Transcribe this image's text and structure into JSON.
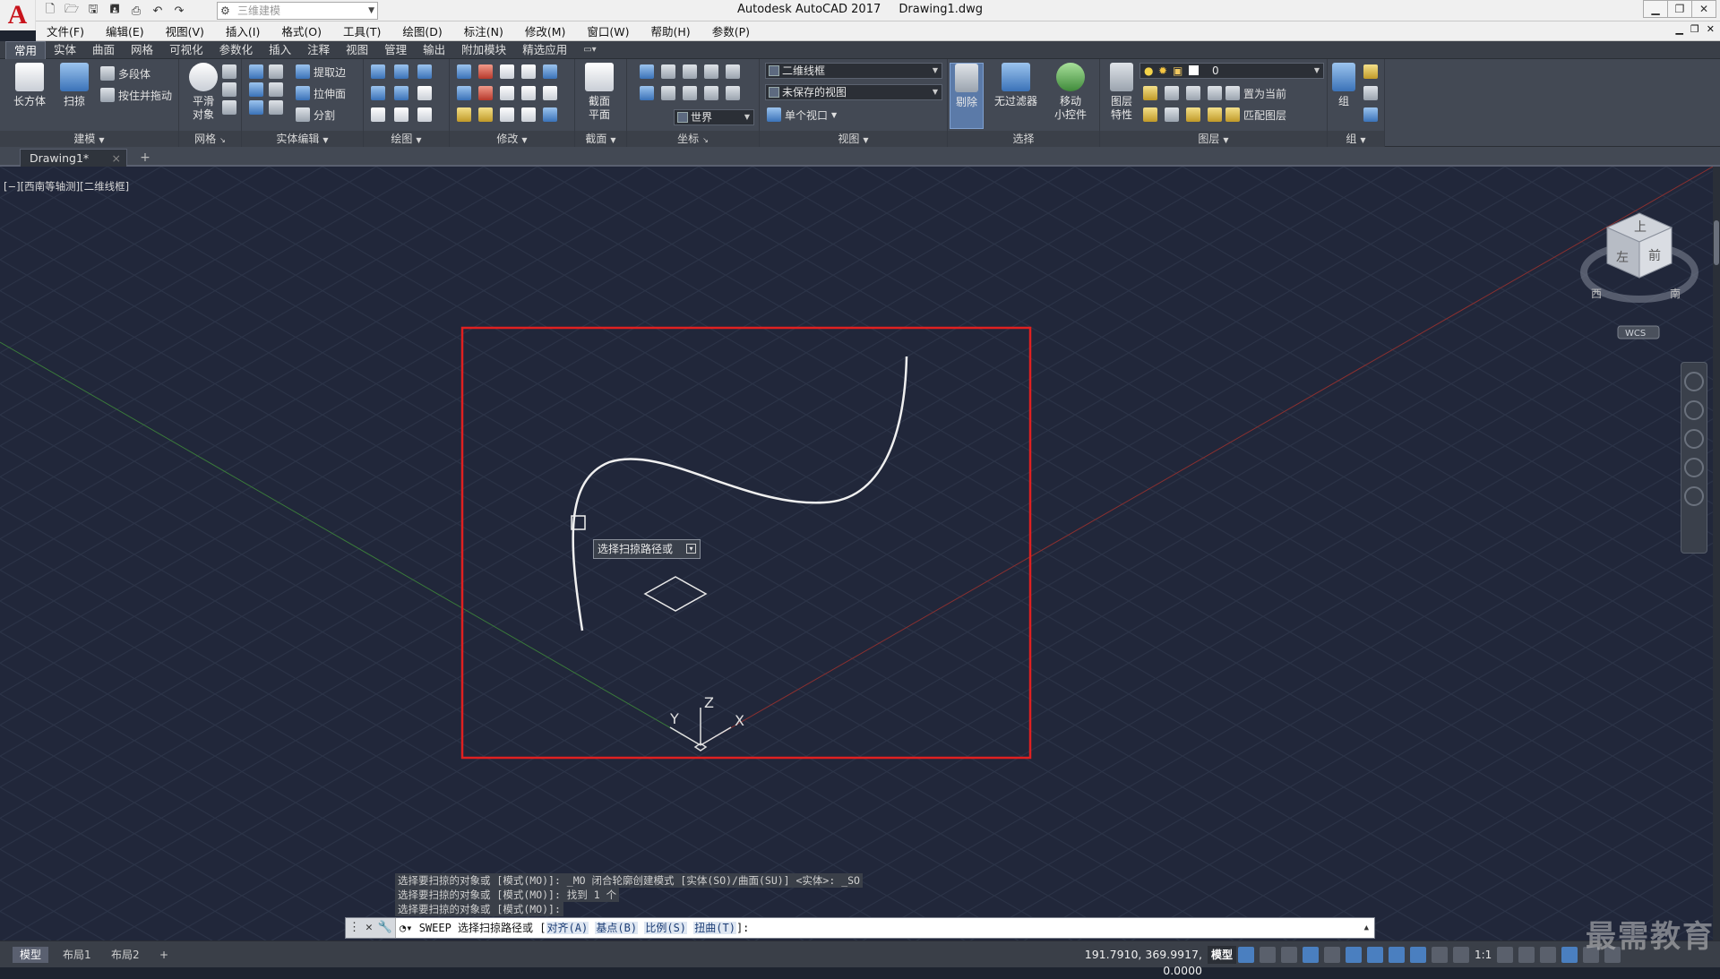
{
  "titlebar": {
    "app_title": "Autodesk AutoCAD 2017",
    "doc_title": "Drawing1.dwg",
    "workspace": "三维建模",
    "logo": "A",
    "quick_access_icons": [
      "new-icon",
      "open-icon",
      "save-icon",
      "saveas-icon",
      "print-icon",
      "undo-icon",
      "redo-icon"
    ],
    "window_controls": [
      "minimize-icon",
      "restore-icon",
      "close-icon"
    ]
  },
  "menubar": {
    "items": [
      "文件(F)",
      "编辑(E)",
      "视图(V)",
      "插入(I)",
      "格式(O)",
      "工具(T)",
      "绘图(D)",
      "标注(N)",
      "修改(M)",
      "窗口(W)",
      "帮助(H)",
      "参数(P)"
    ]
  },
  "ribbon_tabs": {
    "items": [
      "常用",
      "实体",
      "曲面",
      "网格",
      "可视化",
      "参数化",
      "插入",
      "注释",
      "视图",
      "管理",
      "输出",
      "附加模块",
      "精选应用"
    ],
    "active": "常用",
    "ext": "▭▾"
  },
  "ribbon": {
    "model_panel": {
      "label": "建模",
      "box_label": "长方体",
      "sweep_label": "扫掠",
      "polysolid_label": "多段体",
      "presspull_label": "按住并拖动"
    },
    "mesh_panel": {
      "label": "网格",
      "smooth_label_1": "平滑",
      "smooth_label_2": "对象"
    },
    "solid_edit_panel": {
      "label": "实体编辑",
      "extract_label": "提取边",
      "extrude_face_label": "拉伸面",
      "split_label": "分割"
    },
    "draw_panel": {
      "label": "绘图"
    },
    "modify_panel": {
      "label": "修改"
    },
    "section_panel": {
      "label": "截面",
      "plane_label_1": "截面",
      "plane_label_2": "平面"
    },
    "coords_panel": {
      "label": "坐标",
      "world": "世界"
    },
    "view_panel": {
      "label": "视图",
      "visual_style": "二维线框",
      "saved_view": "未保存的视图",
      "viewport": "单个视口"
    },
    "selection_panel": {
      "label": "选择",
      "cull_label": "剔除",
      "filter_label": "无过滤器",
      "gizmo_label_1": "移动",
      "gizmo_label_2": "小控件"
    },
    "layers_panel": {
      "label": "图层",
      "props_label_1": "图层",
      "props_label_2": "特性",
      "layer_value": "0",
      "set_current": "置为当前",
      "match_layer": "匹配图层"
    },
    "groups_panel": {
      "label": "组",
      "group_label": "组"
    }
  },
  "doc_tabs": {
    "active": "Drawing1*",
    "close": "×",
    "add": "+"
  },
  "viewport": {
    "label": "[−][西南等轴测][二维线框]",
    "tooltip": "选择扫掠路径或",
    "ucs_x": "X",
    "ucs_y": "Y",
    "ucs_z": "Z",
    "viewcube_top": "上",
    "viewcube_left": "左",
    "viewcube_front": "前",
    "compass_w": "西",
    "compass_s": "南",
    "wcs": "WCS",
    "highlight_color": "#e02020"
  },
  "command": {
    "history": [
      "选择要扫掠的对象或 [模式(MO)]: _MO 闭合轮廓创建模式 [实体(SO)/曲面(SU)] <实体>: _SO",
      "选择要扫掠的对象或 [模式(MO)]: 找到 1 个",
      "选择要扫掠的对象或 [模式(MO)]:"
    ],
    "prompt_cmd": "SWEEP 选择扫掠路径或 [",
    "options": [
      "对齐(A)",
      "基点(B)",
      "比例(S)",
      "扭曲(T)"
    ],
    "prompt_end": "]:"
  },
  "statusbar": {
    "layouts": [
      "模型",
      "布局1",
      "布局2"
    ],
    "add": "+",
    "coords": "191.7910, 369.9917, 0.0000",
    "model": "模型",
    "scale": "1:1"
  },
  "watermark": "最需教育"
}
